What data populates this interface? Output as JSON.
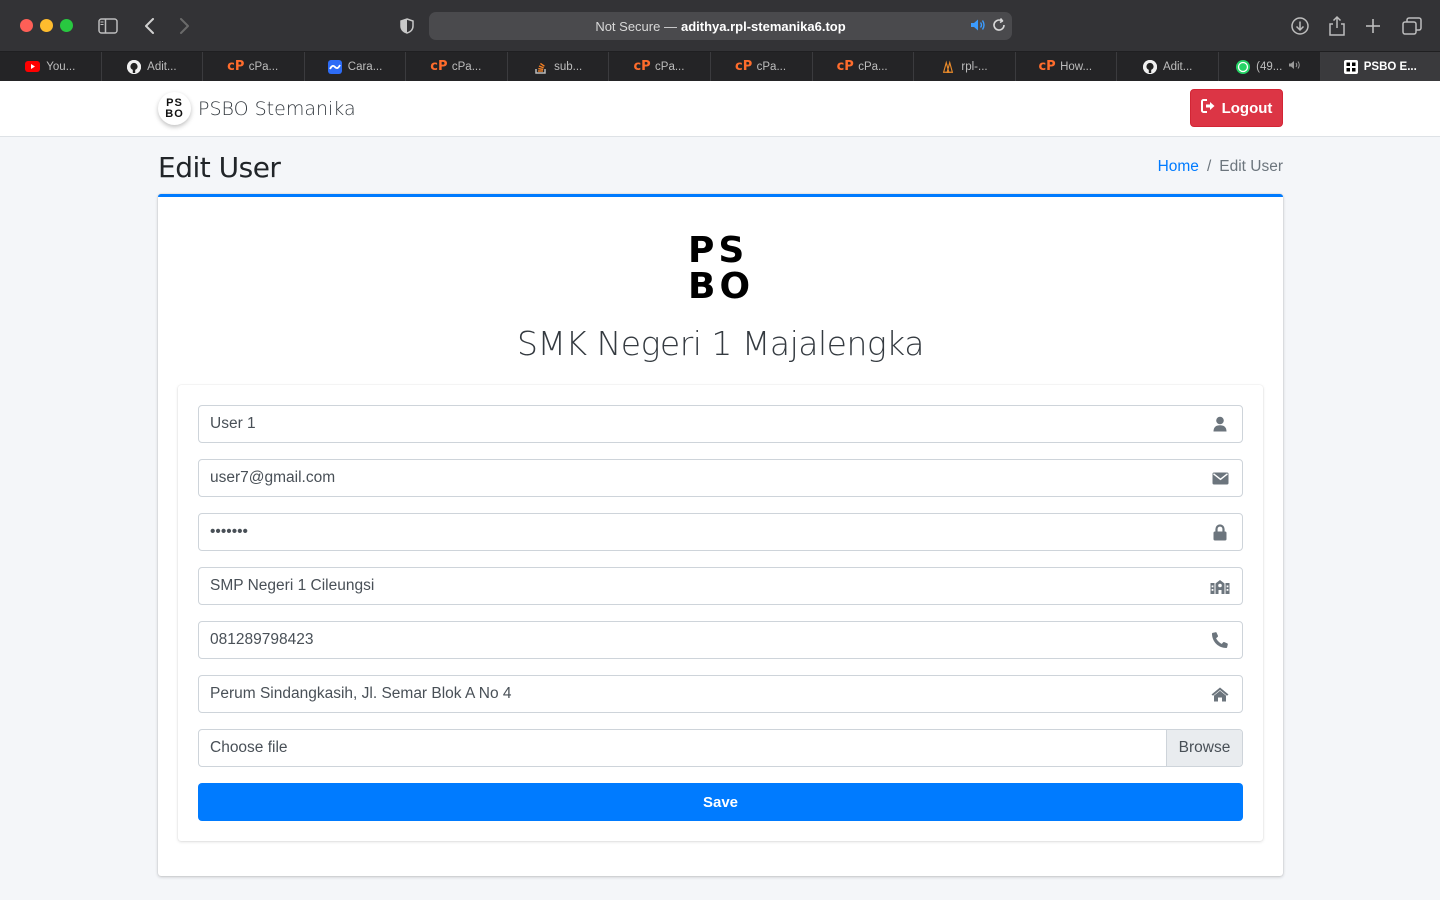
{
  "browser": {
    "url_prefix": "Not Secure —",
    "url_host": "adithya.rpl-stemanika6.top",
    "tabs": [
      {
        "label": "You...",
        "icon": "youtube-icon"
      },
      {
        "label": "Adit...",
        "icon": "github-icon"
      },
      {
        "label": "cPa...",
        "icon": "cpanel-icon"
      },
      {
        "label": "Cara...",
        "icon": "cara-icon"
      },
      {
        "label": "cPa...",
        "icon": "cpanel-icon"
      },
      {
        "label": "sub...",
        "icon": "stackoverflow-icon"
      },
      {
        "label": "cPa...",
        "icon": "cpanel-icon"
      },
      {
        "label": "cPa...",
        "icon": "cpanel-icon"
      },
      {
        "label": "cPa...",
        "icon": "cpanel-icon"
      },
      {
        "label": "rpl-...",
        "icon": "rpl-icon"
      },
      {
        "label": "How...",
        "icon": "cpanel-icon"
      },
      {
        "label": "Adit...",
        "icon": "github-icon"
      },
      {
        "label": "(49...",
        "icon": "whatsapp-icon"
      },
      {
        "label": "PSBO E...",
        "icon": "psbo-icon"
      }
    ]
  },
  "navbar": {
    "brand_logo_line1": "PS",
    "brand_logo_line2": "BO",
    "brand_text": "PSBO Stemanika",
    "logout_label": "Logout"
  },
  "header": {
    "title": "Edit User",
    "breadcrumb_home": "Home",
    "breadcrumb_sep": "/",
    "breadcrumb_current": "Edit User"
  },
  "card": {
    "logo_line1": "PS",
    "logo_line2": "BO",
    "school_name": "SMK Negeri 1 Majalengka"
  },
  "form": {
    "name": "User 1",
    "email": "user7@gmail.com",
    "password": "1234567",
    "school": "SMP Negeri 1 Cileungsi",
    "phone": "081289798423",
    "address": "Perum Sindangkasih, Jl. Semar Blok A No 4",
    "file_label": "Choose file",
    "browse_label": "Browse",
    "save_label": "Save"
  },
  "colors": {
    "primary": "#007bff",
    "danger": "#dc3545",
    "background": "#f4f6f9"
  }
}
